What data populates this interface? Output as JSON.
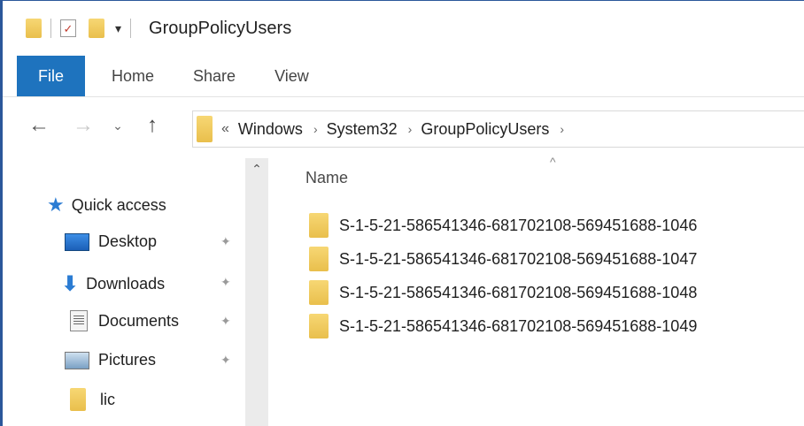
{
  "window": {
    "title": "GroupPolicyUsers",
    "accent": "#1e73be",
    "border_color": "#2b579a"
  },
  "qat": {
    "icons": [
      "folder-icon",
      "properties-check-icon",
      "new-folder-icon",
      "customize-dropdown-icon"
    ],
    "dropdown_glyph": "▾"
  },
  "ribbon": {
    "tabs": [
      {
        "label": "File",
        "active": true
      },
      {
        "label": "Home"
      },
      {
        "label": "Share"
      },
      {
        "label": "View"
      }
    ]
  },
  "navigation": {
    "back_glyph": "←",
    "forward_glyph": "→",
    "recent_glyph": "⌄",
    "up_glyph": "↑",
    "address": {
      "prefix": "«",
      "crumbs": [
        "Windows",
        "System32",
        "GroupPolicyUsers"
      ],
      "separator": "›"
    }
  },
  "nav_pane": {
    "scroll_up_glyph": "⌃",
    "pin_glyph": "📌",
    "items": [
      {
        "label": "Quick access",
        "icon": "star-icon"
      },
      {
        "label": "Desktop",
        "icon": "desktop-icon",
        "pinned": true
      },
      {
        "label": "Downloads",
        "icon": "downloads-icon",
        "pinned": true
      },
      {
        "label": "Documents",
        "icon": "documents-icon",
        "pinned": true
      },
      {
        "label": "Pictures",
        "icon": "pictures-icon",
        "pinned": true
      },
      {
        "label": "lic",
        "icon": "folder-icon"
      }
    ]
  },
  "file_list": {
    "sort_glyph": "^",
    "column_header": "Name",
    "items": [
      "S-1-5-21-586541346-681702108-569451688-1046",
      "S-1-5-21-586541346-681702108-569451688-1047",
      "S-1-5-21-586541346-681702108-569451688-1048",
      "S-1-5-21-586541346-681702108-569451688-1049"
    ]
  }
}
